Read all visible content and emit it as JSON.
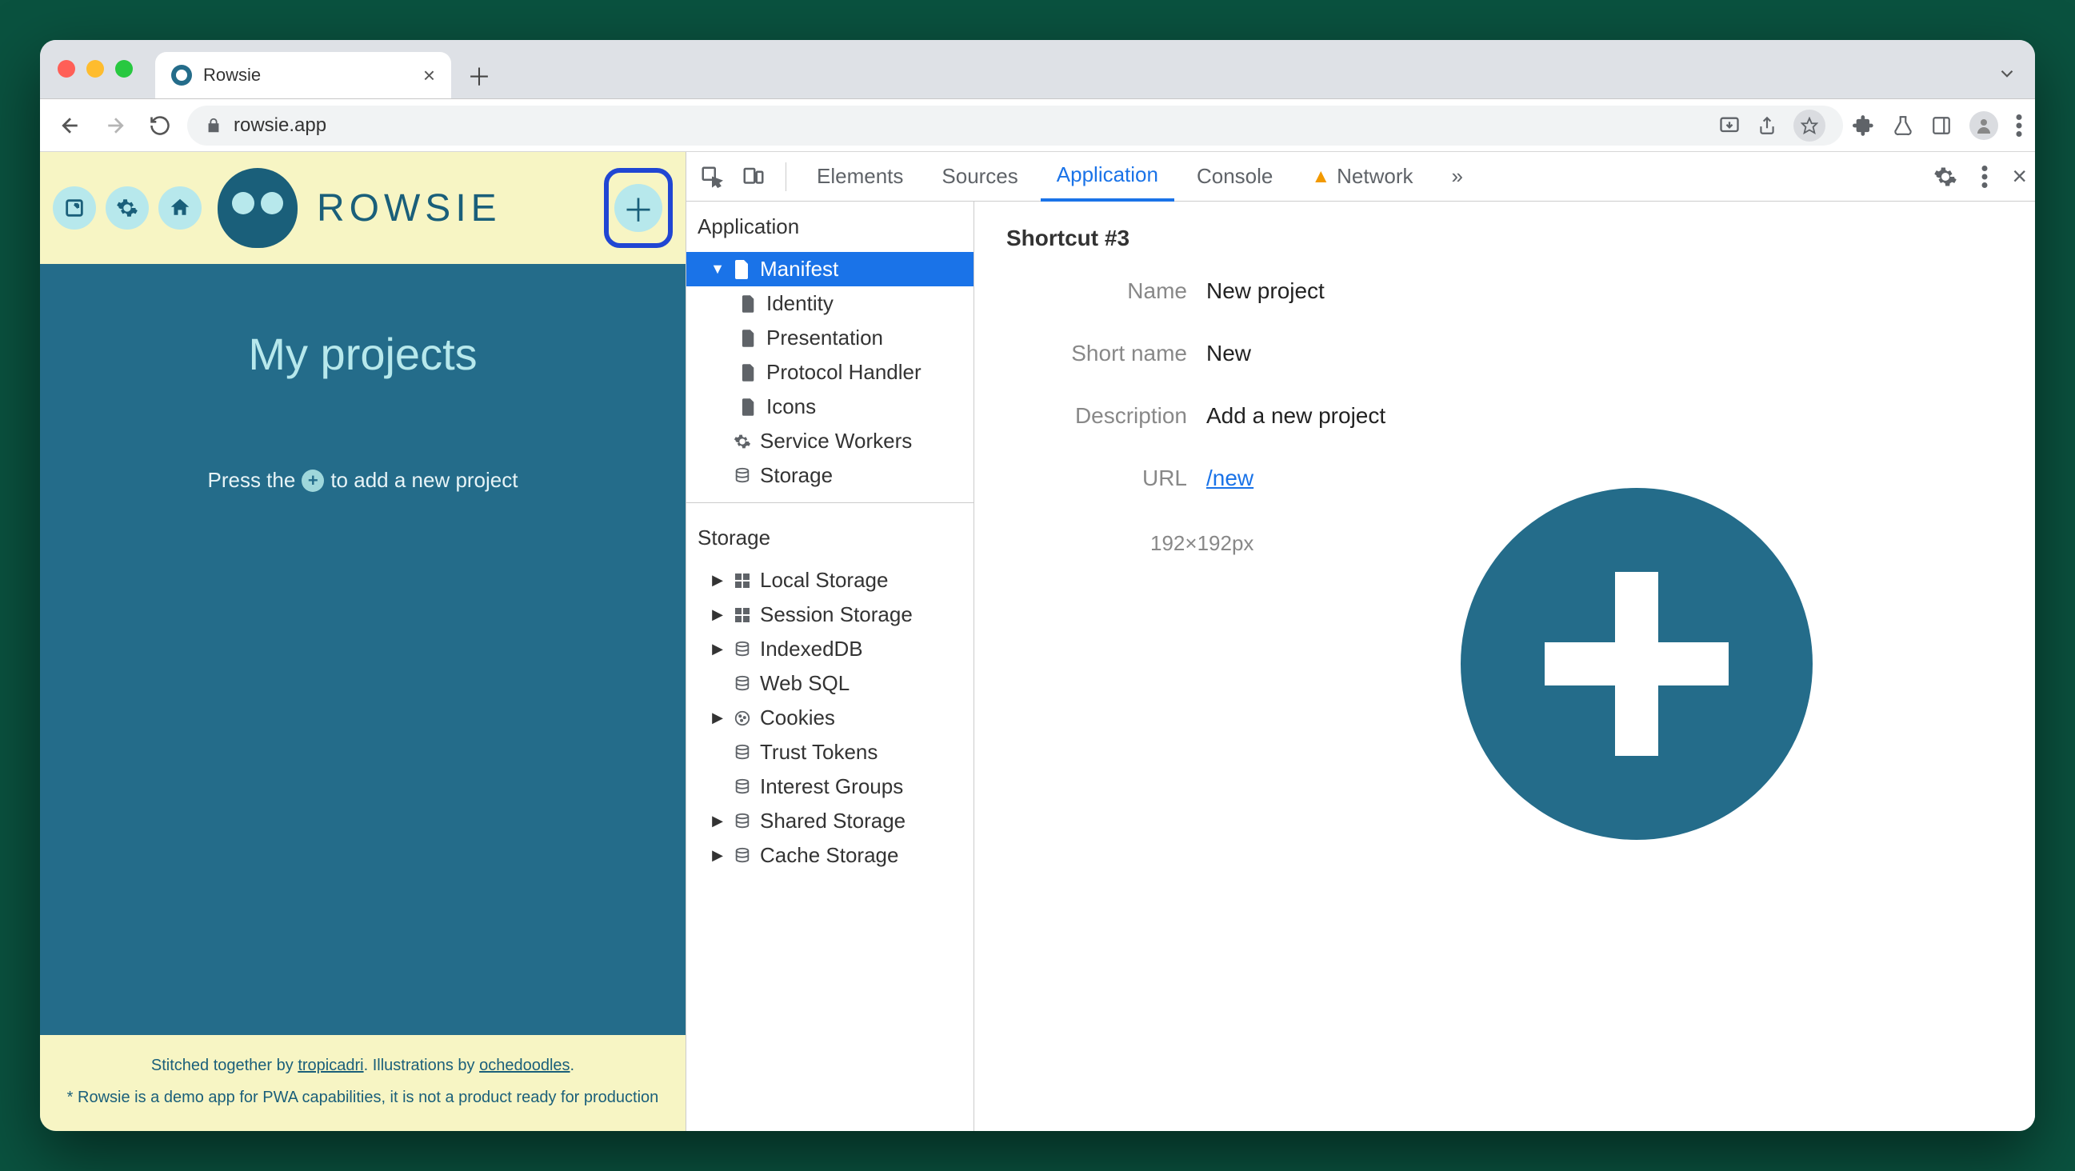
{
  "browser": {
    "tab_title": "Rowsie",
    "url": "rowsie.app"
  },
  "app": {
    "wordmark": "ROWSIE",
    "projects_title": "My projects",
    "hint_before": "Press the",
    "hint_after": "to add a new project",
    "footer_line1_a": "Stitched together by ",
    "footer_line1_link1": "tropicadri",
    "footer_line1_b": ". Illustrations by ",
    "footer_line1_link2": "ochedoodles",
    "footer_line1_c": ".",
    "footer_line2": "* Rowsie is a demo app for PWA capabilities, it is not a product ready for production"
  },
  "devtools": {
    "tabs": {
      "elements": "Elements",
      "sources": "Sources",
      "application": "Application",
      "console": "Console",
      "network": "Network",
      "more": "»"
    },
    "sidebar": {
      "application_label": "Application",
      "manifest": "Manifest",
      "identity": "Identity",
      "presentation": "Presentation",
      "protocol_handler": "Protocol Handler",
      "icons": "Icons",
      "service_workers": "Service Workers",
      "storage_item": "Storage",
      "storage_label": "Storage",
      "local_storage": "Local Storage",
      "session_storage": "Session Storage",
      "indexeddb": "IndexedDB",
      "web_sql": "Web SQL",
      "cookies": "Cookies",
      "trust_tokens": "Trust Tokens",
      "interest_groups": "Interest Groups",
      "shared_storage": "Shared Storage",
      "cache_storage": "Cache Storage"
    },
    "details": {
      "title": "Shortcut #3",
      "name_label": "Name",
      "name_value": "New project",
      "shortname_label": "Short name",
      "shortname_value": "New",
      "description_label": "Description",
      "description_value": "Add a new project",
      "url_label": "URL",
      "url_value": "/new",
      "icon_dim": "192×192px"
    }
  }
}
